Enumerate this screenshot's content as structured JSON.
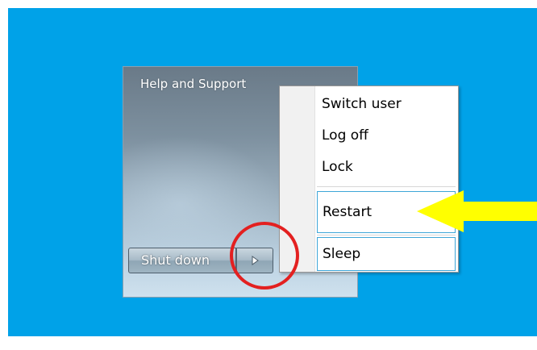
{
  "start_menu": {
    "help_support_label": "Help and Support",
    "shutdown_label": "Shut down",
    "shutdown_arrow_icon": "triangle-right-icon"
  },
  "context_menu": {
    "items": [
      {
        "label": "Switch user"
      },
      {
        "label": "Log off"
      },
      {
        "label": "Lock"
      },
      {
        "label": "Restart"
      },
      {
        "label": "Sleep"
      }
    ]
  },
  "annotations": {
    "circle_color": "#e32020",
    "arrow_color": "#ffff00"
  },
  "colors": {
    "desktop_background": "#00a2e8",
    "menu_highlight_border": "#3fa6d8"
  }
}
